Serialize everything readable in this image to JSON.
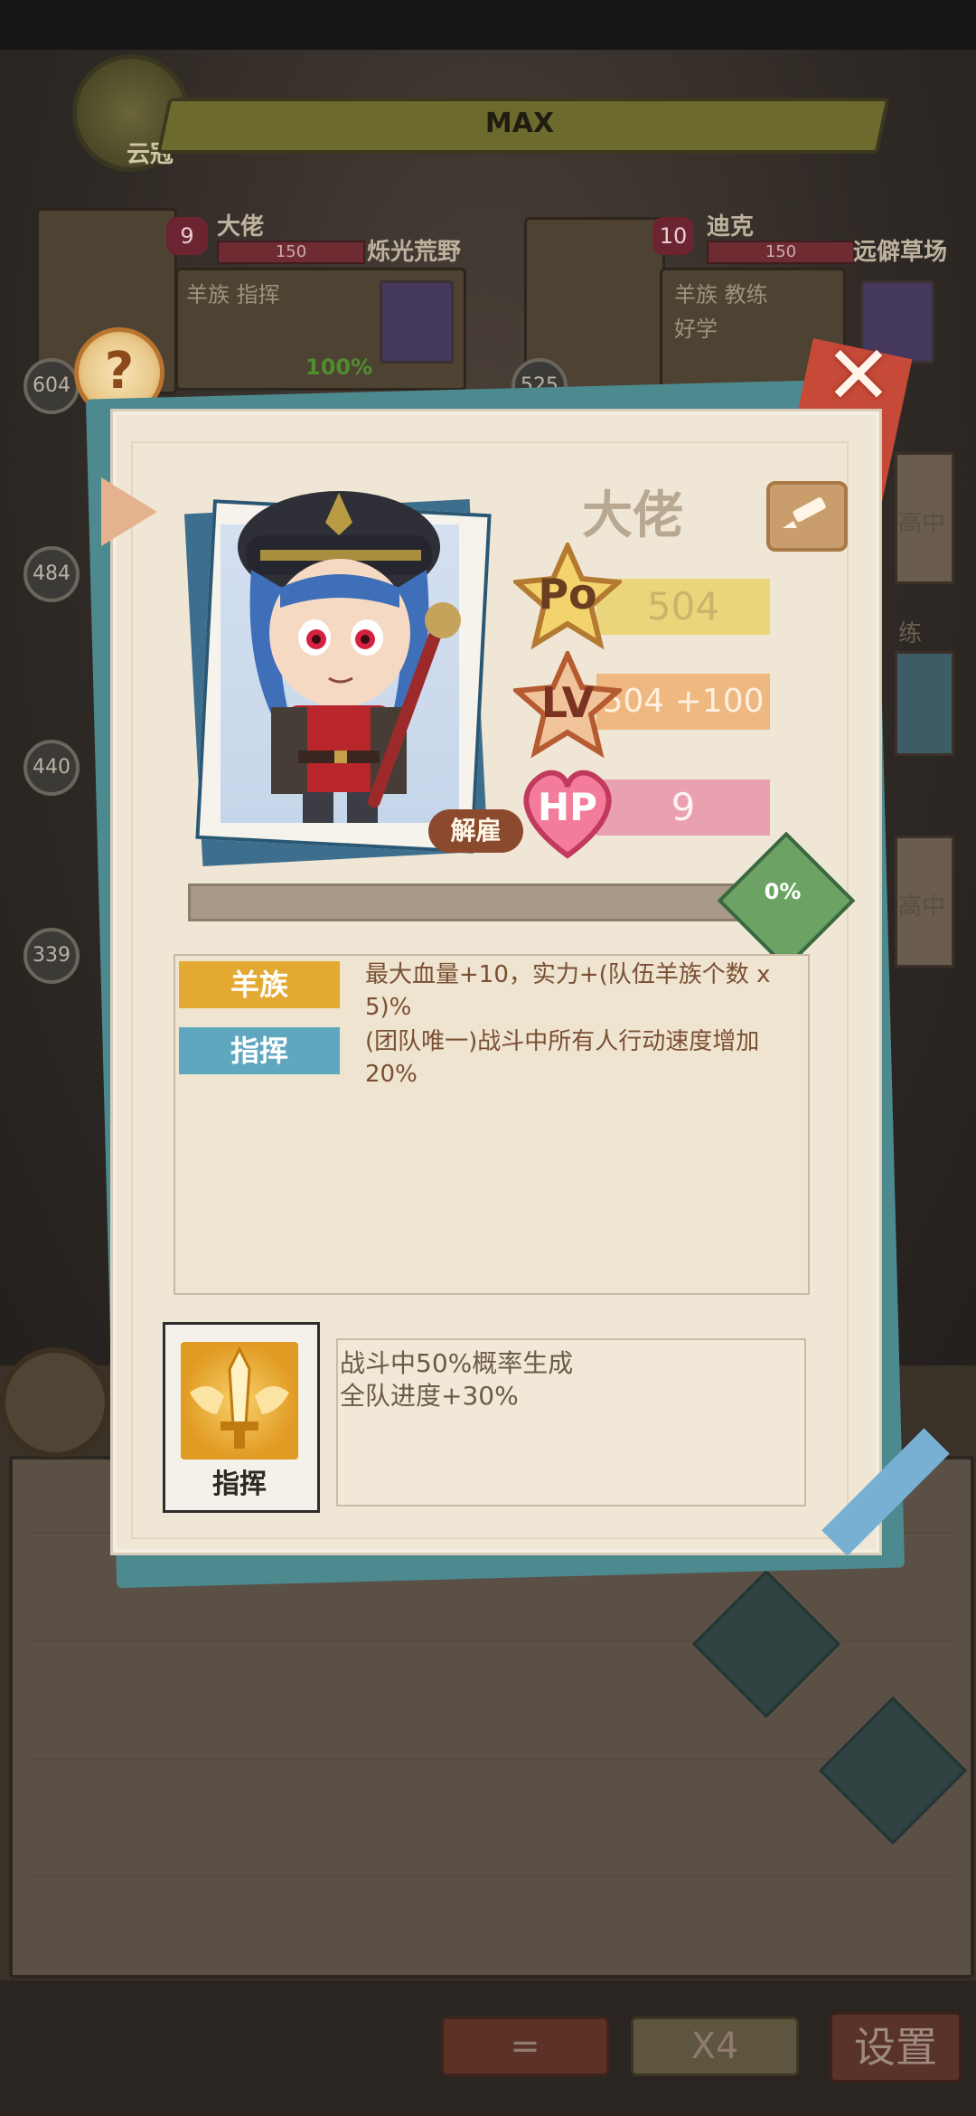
{
  "hud": {
    "max_label": "MAX",
    "crest_label": "云冠"
  },
  "background_cards": [
    {
      "hp": "9",
      "name": "大佬",
      "hp_value": "150",
      "location": "烁光荒野",
      "traits": "羊族  指挥",
      "progress": "100%",
      "power": "604"
    },
    {
      "hp": "10",
      "name": "迪克",
      "hp_value": "150",
      "location": "远僻草场",
      "traits": "羊族  教练",
      "trait_extra": "好学",
      "power": "525"
    }
  ],
  "background_left_numbers": [
    "484",
    "440",
    "339"
  ],
  "background_right_labels": [
    "高中",
    "练",
    "高中"
  ],
  "bottom_buttons": {
    "equals": "=",
    "speed": "X4",
    "settings": "设置"
  },
  "popup": {
    "character_name": "大佬",
    "dismiss_label": "解雇",
    "stats": {
      "po_badge": "Po",
      "po_value": "504",
      "lv_badge": "LV",
      "lv_value": "504 +100",
      "hp_badge": "HP",
      "hp_value": "9"
    },
    "progress": {
      "value": 0.0,
      "label": "0%"
    },
    "traits": [
      {
        "tag": "羊族",
        "description": "最大血量+10，实力+(队伍羊族个数 x 5)%"
      },
      {
        "tag": "指挥",
        "description": "(团队唯一)战斗中所有人行动速度增加20%"
      }
    ],
    "skill": {
      "name": "指挥",
      "lines": [
        "战斗中50%概率生成",
        "全队进度+30%"
      ]
    }
  },
  "colors": {
    "panel": "#efe6d5",
    "trait_gold": "#e3a933",
    "trait_blue": "#5fa7bf",
    "close_red": "#c64a37"
  },
  "icons": [
    "help-icon",
    "close-icon",
    "edit-pencil-icon",
    "sword-wings-icon",
    "clock-icon",
    "potion-icon"
  ]
}
